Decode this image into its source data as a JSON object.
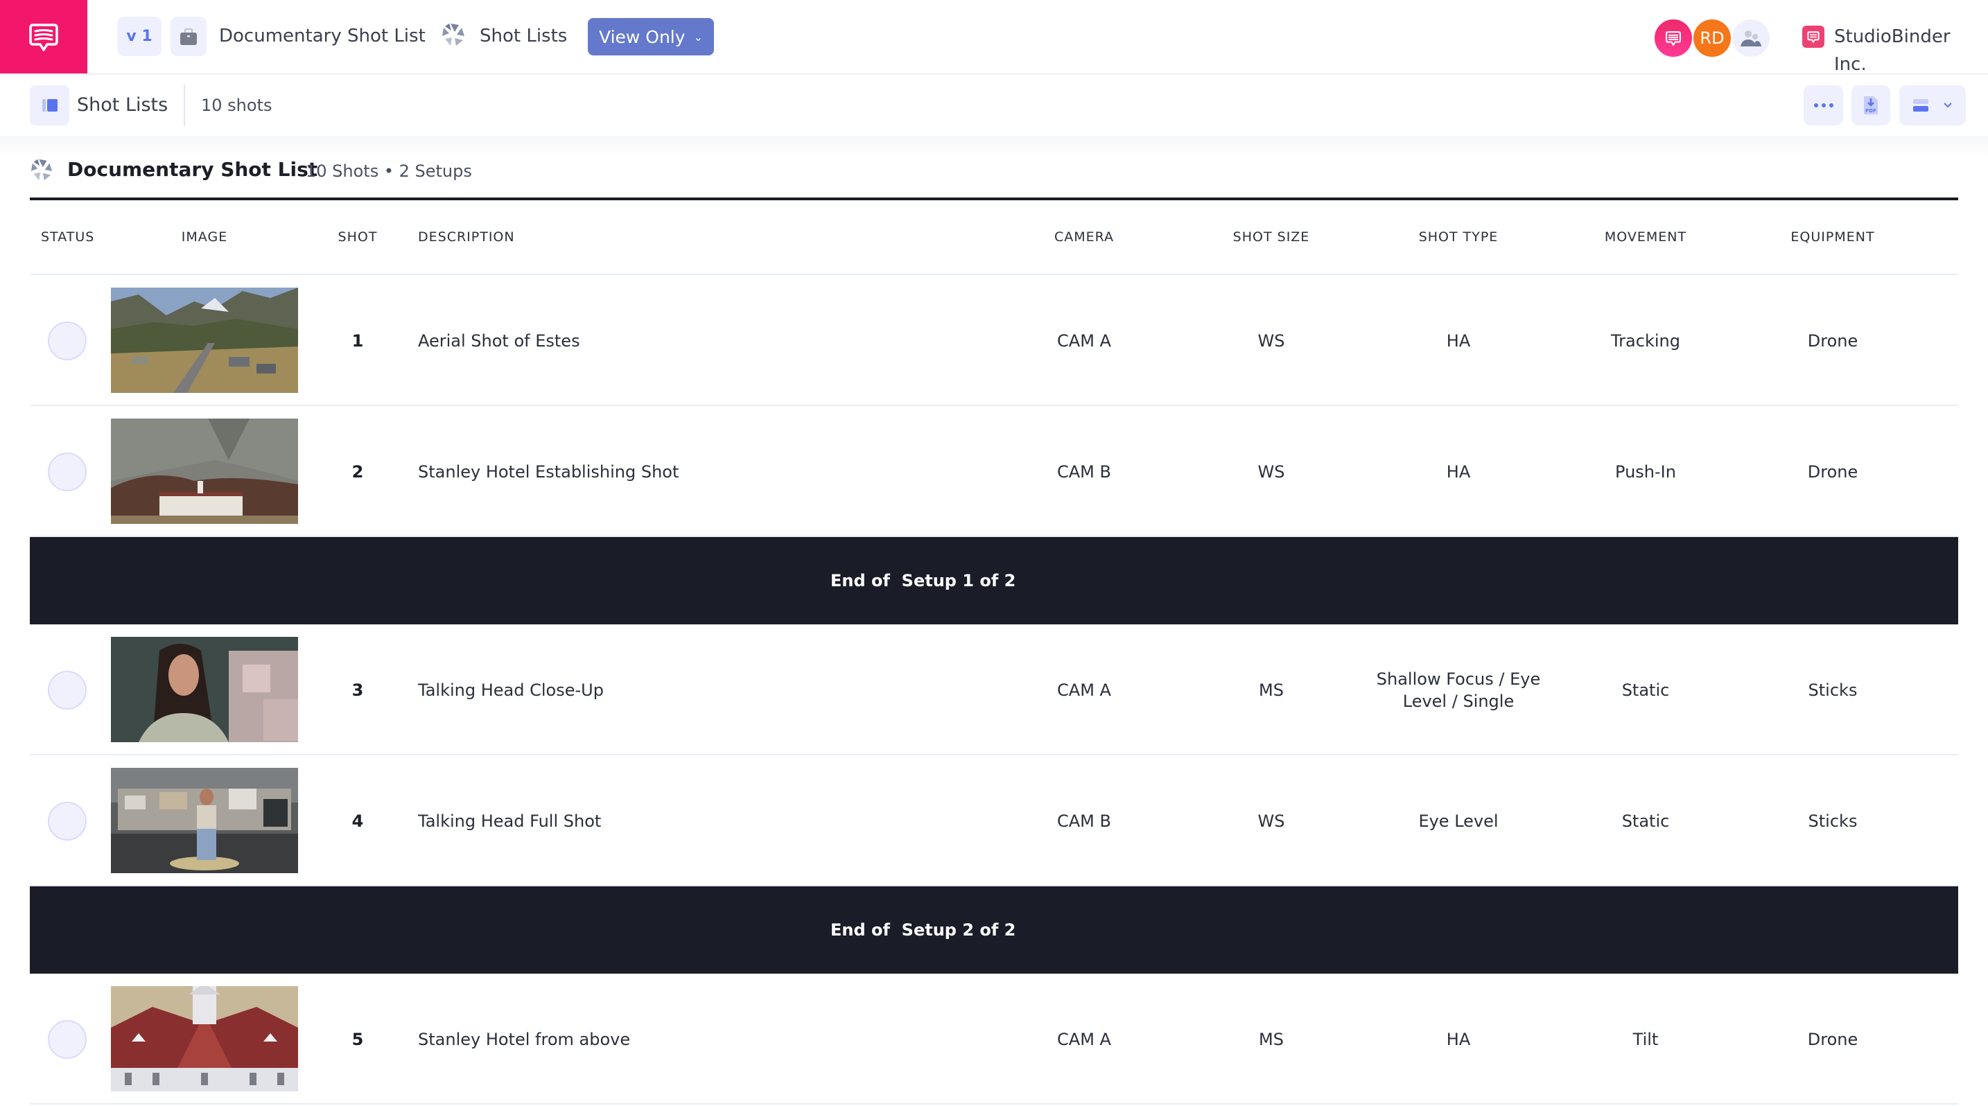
{
  "app": {
    "brand_color": "#f2176b",
    "version_label": "v 1",
    "project_title": "Documentary Shot List",
    "section_link": "Shot Lists",
    "permission_button": "View Only",
    "org_name": "StudioBinder Inc.",
    "avatars": [
      {
        "type": "logo",
        "color": "#f0306f"
      },
      {
        "initials": "RD",
        "color": "#f6761a"
      },
      {
        "type": "team-icon",
        "color": "#eff0fd"
      }
    ]
  },
  "subbar": {
    "title": "Shot Lists",
    "count": "10 shots",
    "actions": [
      "more-options",
      "export-pdf",
      "view-mode"
    ]
  },
  "shotlist": {
    "title": "Documentary Shot List",
    "meta": "10 Shots • 2 Setups"
  },
  "table": {
    "headers": {
      "status": "STATUS",
      "image": "IMAGE",
      "shot": "SHOT",
      "description": "DESCRIPTION",
      "camera": "CAMERA",
      "shot_size": "SHOT SIZE",
      "shot_type": "SHOT TYPE",
      "movement": "MOVEMENT",
      "equipment": "EQUIPMENT"
    },
    "rows": [
      {
        "shot": "1",
        "description": "Aerial Shot of Estes",
        "camera": "CAM A",
        "shot_size": "WS",
        "shot_type": "HA",
        "movement": "Tracking",
        "equipment": "Drone",
        "image": "mountain-town-aerial"
      },
      {
        "shot": "2",
        "description": "Stanley Hotel Establishing Shot",
        "camera": "CAM B",
        "shot_size": "WS",
        "shot_type": "HA",
        "movement": "Push-In",
        "equipment": "Drone",
        "image": "hotel-mountain"
      },
      {
        "shot": "3",
        "description": "Talking Head Close-Up",
        "camera": "CAM A",
        "shot_size": "MS",
        "shot_type": "Shallow Focus / Eye Level / Single",
        "movement": "Static",
        "equipment": "Sticks",
        "image": "woman-closeup"
      },
      {
        "shot": "4",
        "description": "Talking Head Full Shot",
        "camera": "CAM B",
        "shot_size": "WS",
        "shot_type": "Eye Level",
        "movement": "Static",
        "equipment": "Sticks",
        "image": "woman-warehouse"
      },
      {
        "shot": "5",
        "description": "Stanley Hotel from above",
        "camera": "CAM A",
        "shot_size": "MS",
        "shot_type": "HA",
        "movement": "Tilt",
        "equipment": "Drone",
        "image": "hotel-roof-aerial"
      }
    ],
    "setups": [
      {
        "label": "End of  Setup 1 of 2"
      },
      {
        "label": "End of  Setup 2 of 2"
      }
    ]
  }
}
